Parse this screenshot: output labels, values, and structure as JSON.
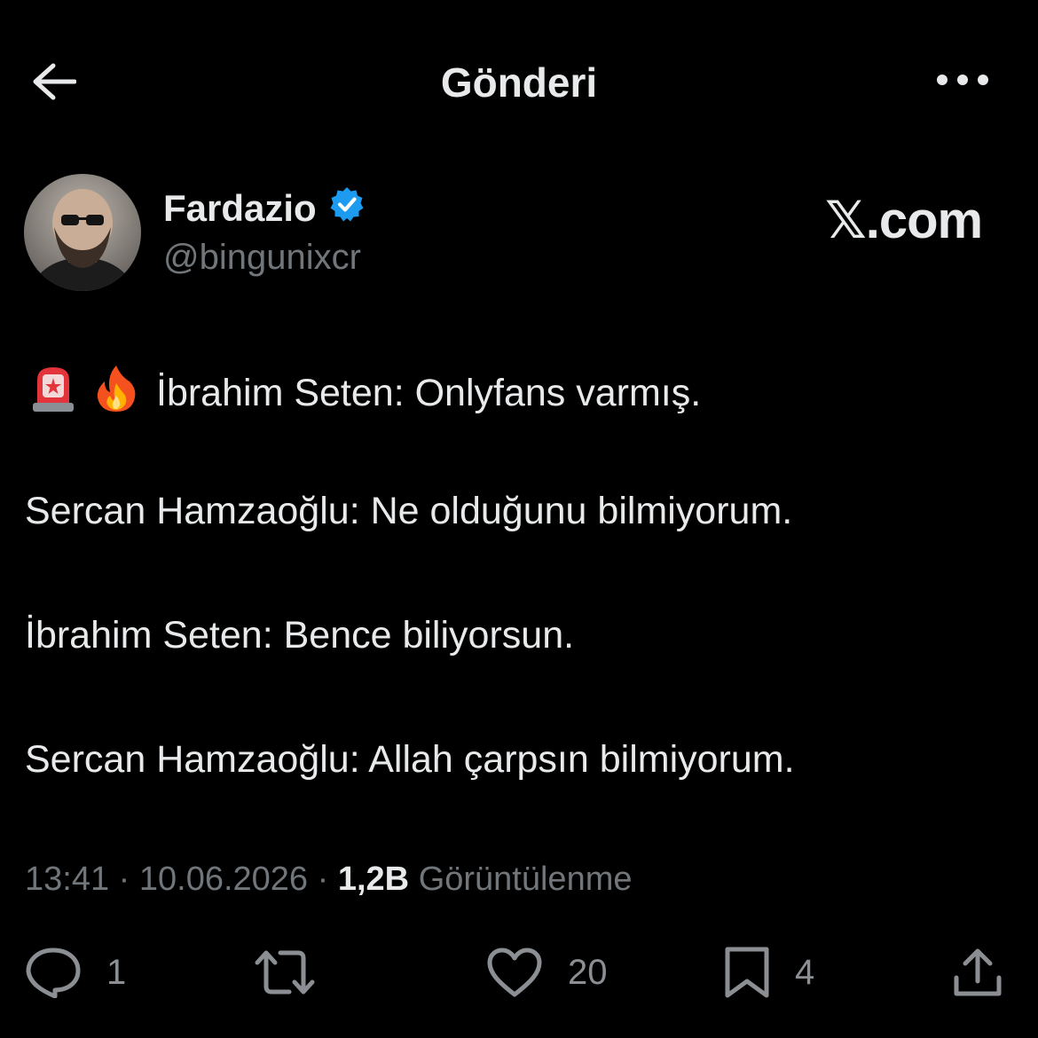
{
  "header": {
    "title": "Gönderi",
    "back_icon": "arrow-left-icon",
    "more_icon": "ellipsis-horizontal-icon"
  },
  "author": {
    "name": "Fardazio",
    "handle": "@bingunixcr",
    "verified": true,
    "verified_color": "#1d9bf0",
    "brand": "𝕏.com"
  },
  "tweet": {
    "emojis": [
      "police-light-emoji",
      "fire-emoji"
    ],
    "lines": [
      "İbrahim Seten: Onlyfans varmış.",
      "Sercan Hamzaoğlu: Ne olduğunu bilmiyorum.",
      "İbrahim Seten: Bence biliyorsun.",
      "Sercan Hamzaoğlu: Allah çarpsın bilmiyorum."
    ]
  },
  "meta": {
    "time": "13:41",
    "separator": "·",
    "date": "10.06.2026",
    "views": "1,2B",
    "views_label": "Görüntülenme"
  },
  "actions": {
    "replies": "1",
    "reposts": "",
    "likes": "20",
    "bookmarks": "4"
  },
  "colors": {
    "background": "#000000",
    "text": "#e7e9ea",
    "secondary": "#71767b"
  }
}
